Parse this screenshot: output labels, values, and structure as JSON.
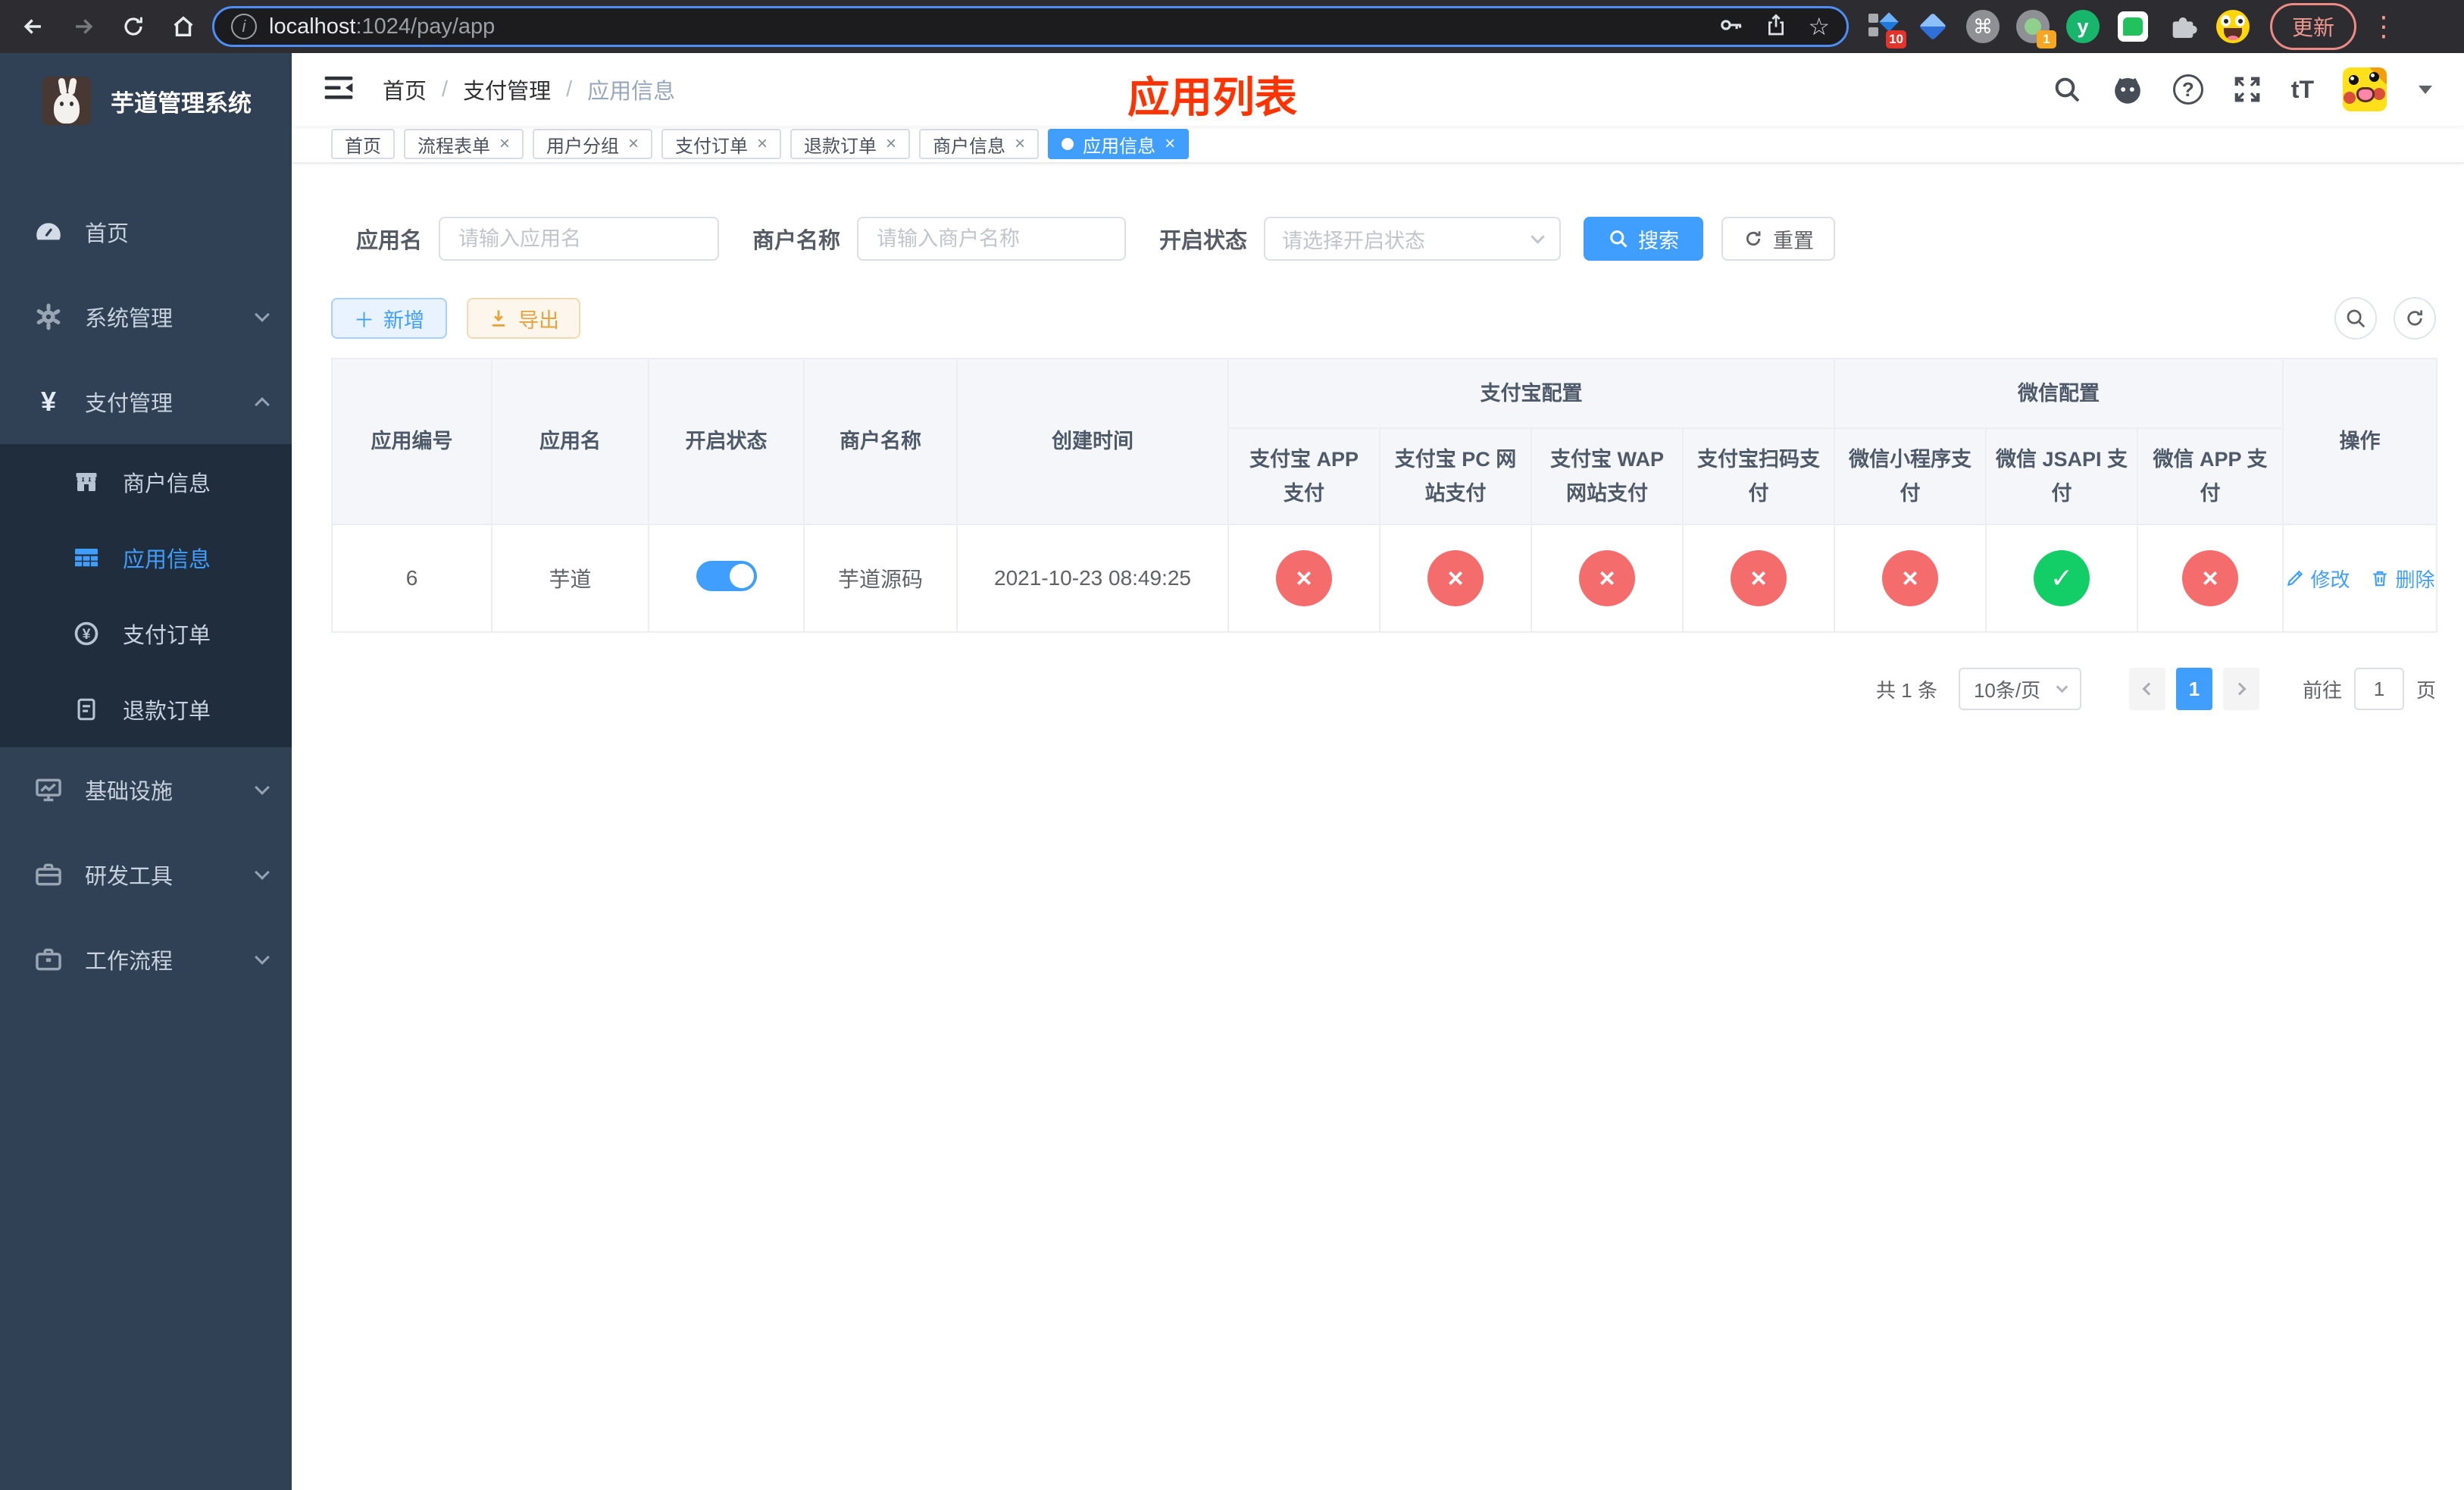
{
  "browser": {
    "url": {
      "host": "localhost",
      "rest": ":1024/pay/app"
    },
    "update_label": "更新",
    "ext_badge_tabs": "10",
    "ext_badge_rec": "1"
  },
  "icons": {
    "close": "×",
    "check": "✓",
    "cross": "×",
    "kebab": "⋮",
    "star": "☆",
    "info": "i",
    "question": "?",
    "font_size": "tT",
    "command": "⌘",
    "monica": "y",
    "yen": "¥",
    "plus": "＋"
  },
  "sidebar": {
    "title": "芋道管理系统",
    "items": [
      {
        "label": "首页"
      },
      {
        "label": "系统管理"
      },
      {
        "label": "支付管理"
      },
      {
        "label": "商户信息"
      },
      {
        "label": "应用信息"
      },
      {
        "label": "支付订单"
      },
      {
        "label": "退款订单"
      },
      {
        "label": "基础设施"
      },
      {
        "label": "研发工具"
      },
      {
        "label": "工作流程"
      }
    ]
  },
  "breadcrumb": {
    "items": [
      "首页",
      "支付管理",
      "应用信息"
    ],
    "separator": "/"
  },
  "page_title": "应用列表",
  "tabs": [
    {
      "label": "首页"
    },
    {
      "label": "流程表单"
    },
    {
      "label": "用户分组"
    },
    {
      "label": "支付订单"
    },
    {
      "label": "退款订单"
    },
    {
      "label": "商户信息"
    },
    {
      "label": "应用信息"
    }
  ],
  "filters": {
    "app_name_label": "应用名",
    "app_name_placeholder": "请输入应用名",
    "merchant_label": "商户名称",
    "merchant_placeholder": "请输入商户名称",
    "status_label": "开启状态",
    "status_placeholder": "请选择开启状态",
    "search_label": "搜索",
    "reset_label": "重置"
  },
  "toolbar": {
    "add_label": "新增",
    "export_label": "导出"
  },
  "table": {
    "columns": {
      "id": "应用编号",
      "name": "应用名",
      "status": "开启状态",
      "merchant": "商户名称",
      "created": "创建时间",
      "alipay_group": "支付宝配置",
      "wechat_group": "微信配置",
      "alipay": [
        "支付宝 APP 支付",
        "支付宝 PC 网站支付",
        "支付宝 WAP 网站支付",
        "支付宝扫码支付"
      ],
      "wechat": [
        "微信小程序支付",
        "微信 JSAPI 支付",
        "微信 APP 支付"
      ],
      "actions": "操作"
    },
    "row": {
      "id": "6",
      "name": "芋道",
      "enabled": true,
      "merchant": "芋道源码",
      "created": "2021-10-23 08:49:25",
      "statuses": [
        false,
        false,
        false,
        false,
        false,
        true,
        false
      ],
      "edit_label": "修改",
      "delete_label": "删除"
    }
  },
  "pagination": {
    "total": "共 1 条",
    "page_size": "10条/页",
    "current": "1",
    "goto_label": "前往",
    "goto_value": "1",
    "page_label": "页"
  },
  "colors": {
    "primary": "#409EFF",
    "danger": "#f56c6c",
    "success": "#13ce66",
    "title_red": "#ff3300",
    "sidebar": "#304156"
  }
}
